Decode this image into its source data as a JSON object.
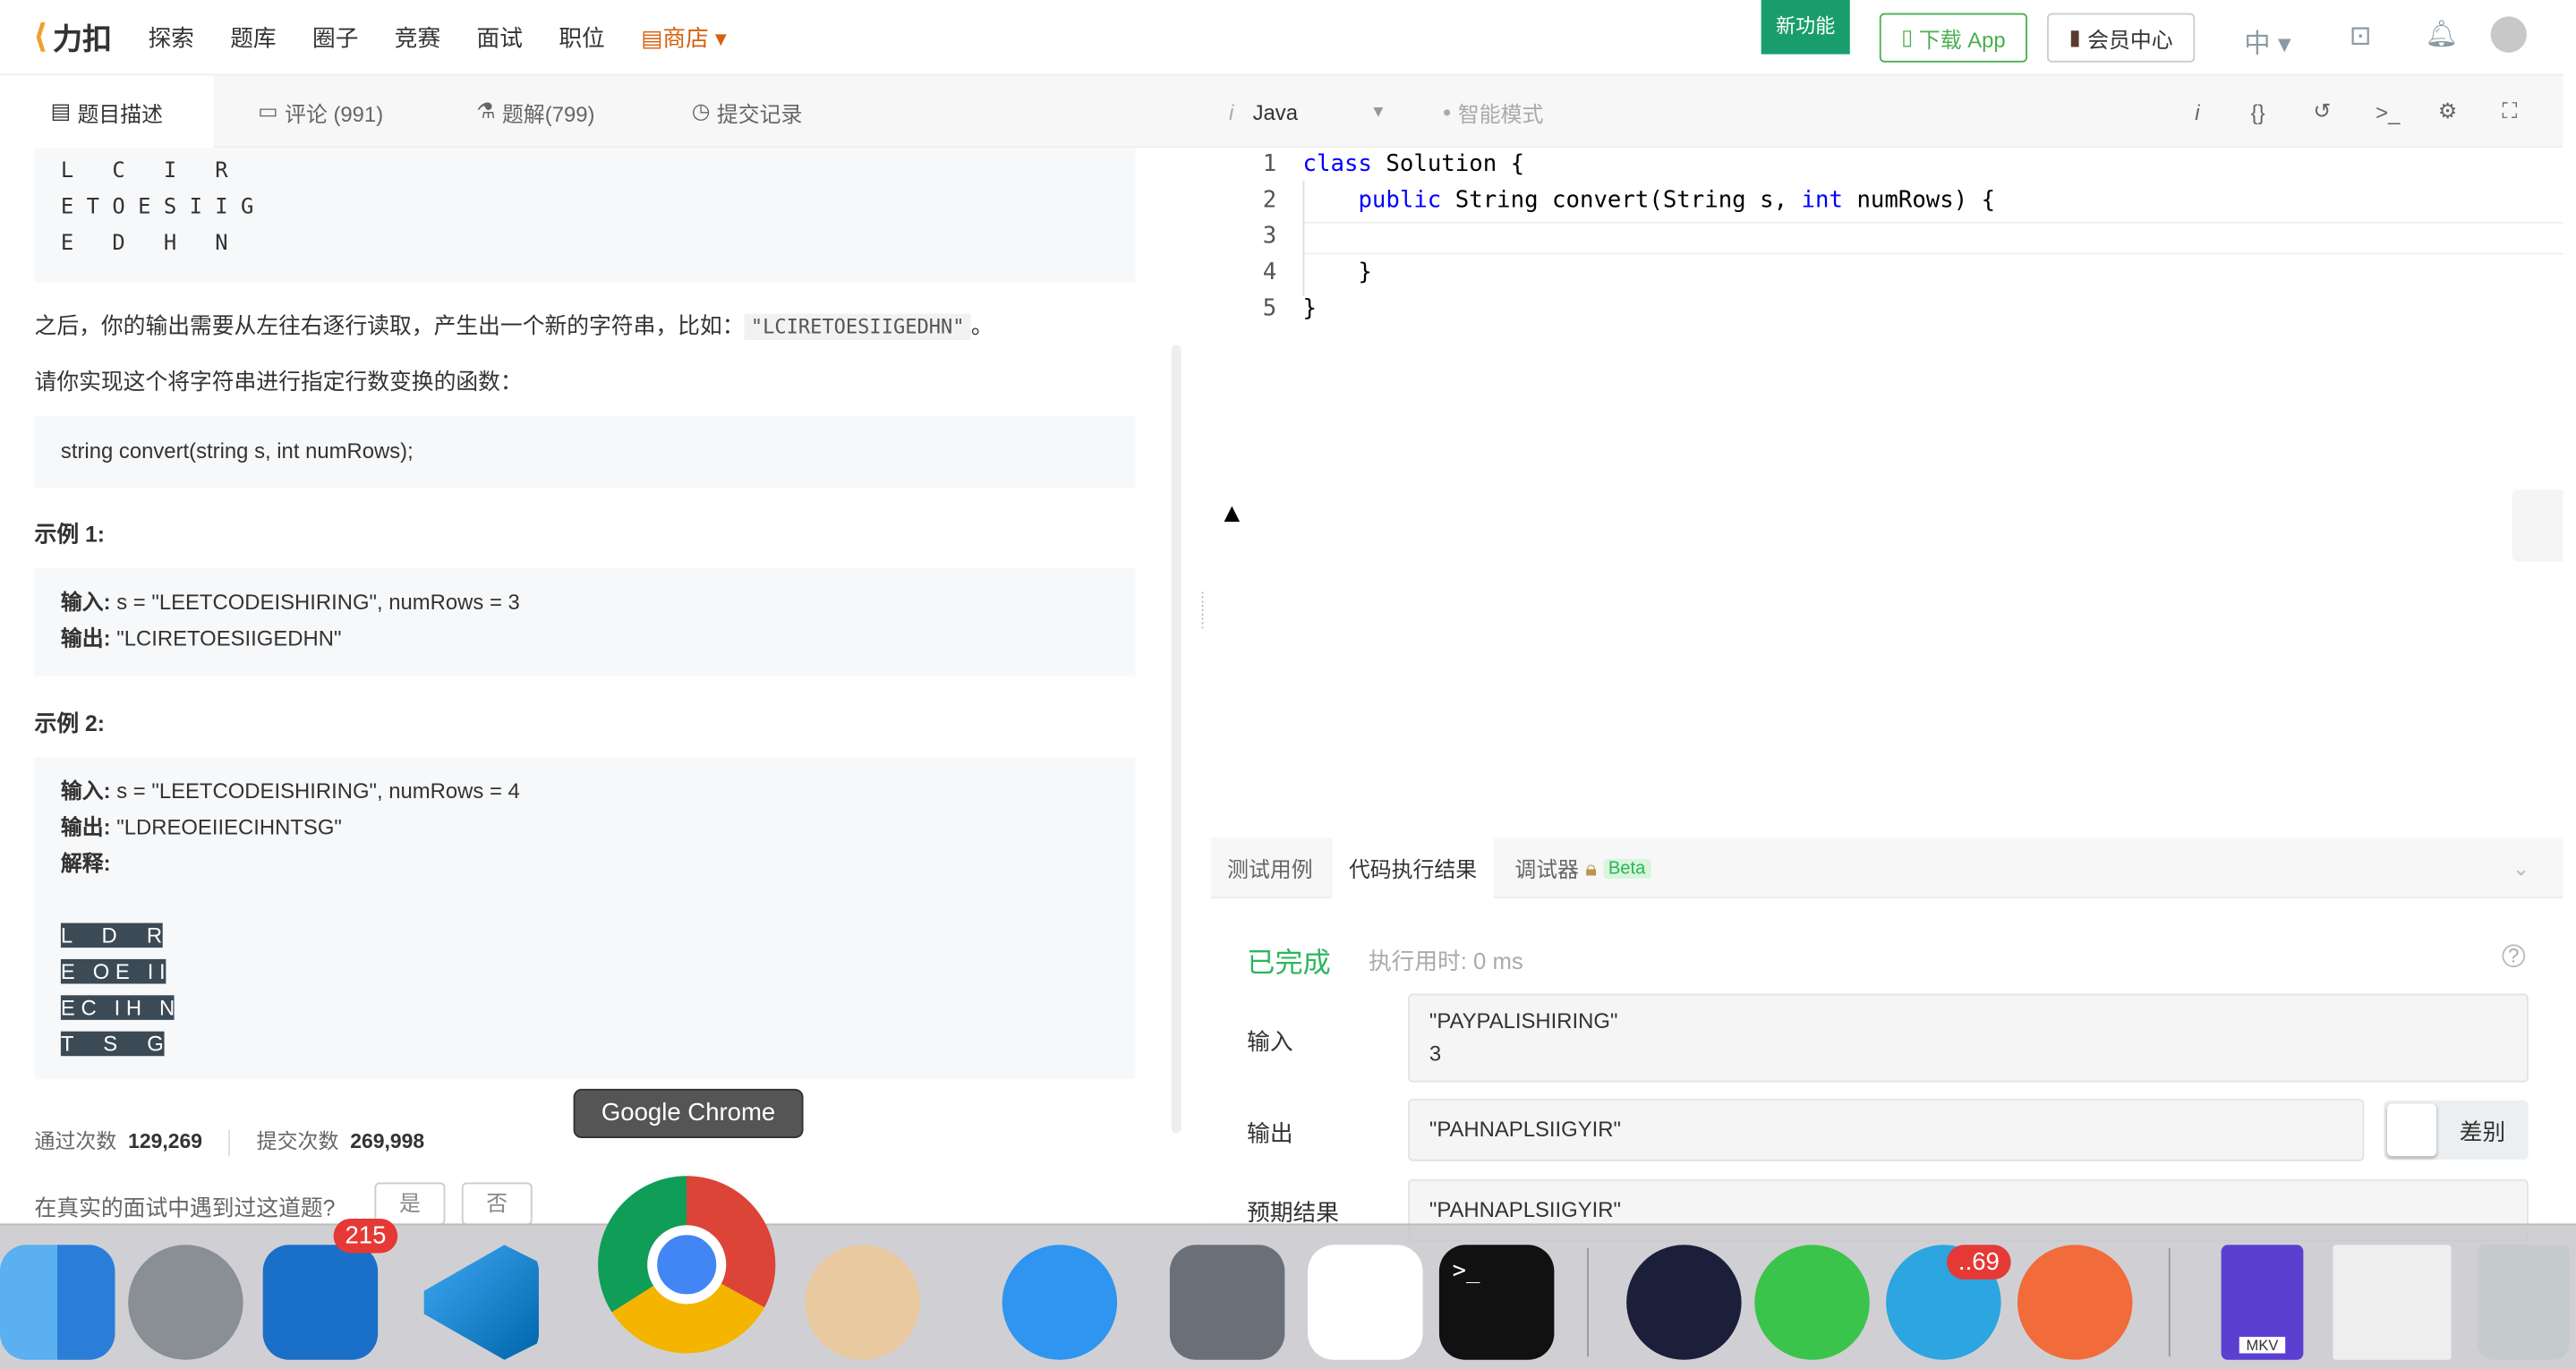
{
  "nav": {
    "logo": "力扣",
    "items": [
      "探索",
      "题库",
      "圈子",
      "竞赛",
      "面试",
      "职位"
    ],
    "shop": "商店",
    "new_feature": "新功能",
    "download": "下载 App",
    "vip": "会员中心",
    "lang": "中"
  },
  "tabs": {
    "desc": "题目描述",
    "comments": "评论 (991)",
    "solutions": "题解(799)",
    "submissions": "提交记录"
  },
  "editor_bar": {
    "language": "Java",
    "smart_mode": "智能模式"
  },
  "problem": {
    "zigzag1": "L   C   I   R\nE T O E S I I G\nE   D   H   N",
    "after_text": "之后，你的输出需要从左往右逐行读取，产生出一个新的字符串，比如：",
    "after_code": "\"LCIRETOESIIGEDHN\"",
    "after_end": "。",
    "impl_text": "请你实现这个将字符串进行指定行数变换的函数：",
    "signature": "string convert(string s, int numRows);",
    "ex1_title": "示例 1:",
    "ex1_in_label": "输入:",
    "ex1_in": " s = \"LEETCODEISHIRING\", numRows = 3",
    "ex1_out_label": "输出:",
    "ex1_out": " \"LCIRETOESIIGEDHN\"",
    "ex2_title": "示例 2:",
    "ex2_in_label": "输入:",
    "ex2_in": " s = \"LEETCODEISHIRING\", numRows = 4",
    "ex2_out_label": "输出:",
    "ex2_out": " \"LDREOEIIECIHNTSG\"",
    "ex2_explain": "解释:",
    "zigzag2": [
      "L     D     R",
      "E   O E   I I",
      "E C   I H   N",
      "T     S     G"
    ],
    "accepted_label": "通过次数",
    "accepted": "129,269",
    "submitted_label": "提交次数",
    "submitted": "269,998",
    "interview_q": "在真实的面试中遇到过这道题?",
    "yes": "是",
    "no": "否"
  },
  "code": [
    "class Solution {",
    "    public String convert(String s, int numRows) {",
    "",
    "    }",
    "}"
  ],
  "bottom": {
    "tabs": [
      "测试用例",
      "代码执行结果",
      "调试器"
    ],
    "beta": "Beta",
    "status": "已完成",
    "time": "执行用时: 0 ms",
    "input_label": "输入",
    "input": [
      "\"PAYPALISHIRING\"",
      "3"
    ],
    "output_label": "输出",
    "output": "\"PAHNAPLSIIGYIR\"",
    "diff": "差别",
    "expected_label": "预期结果",
    "expected": "\"PAHNAPLSIIGYIR\""
  },
  "dock": {
    "tooltip": "Google Chrome",
    "outlook_badge": "215",
    "telegram_badge": "..69",
    "mkv_label": "MKV"
  },
  "colors": {
    "accent_green": "#2db55d",
    "brand_orange": "#f0a030",
    "shop": "#d4600f"
  }
}
